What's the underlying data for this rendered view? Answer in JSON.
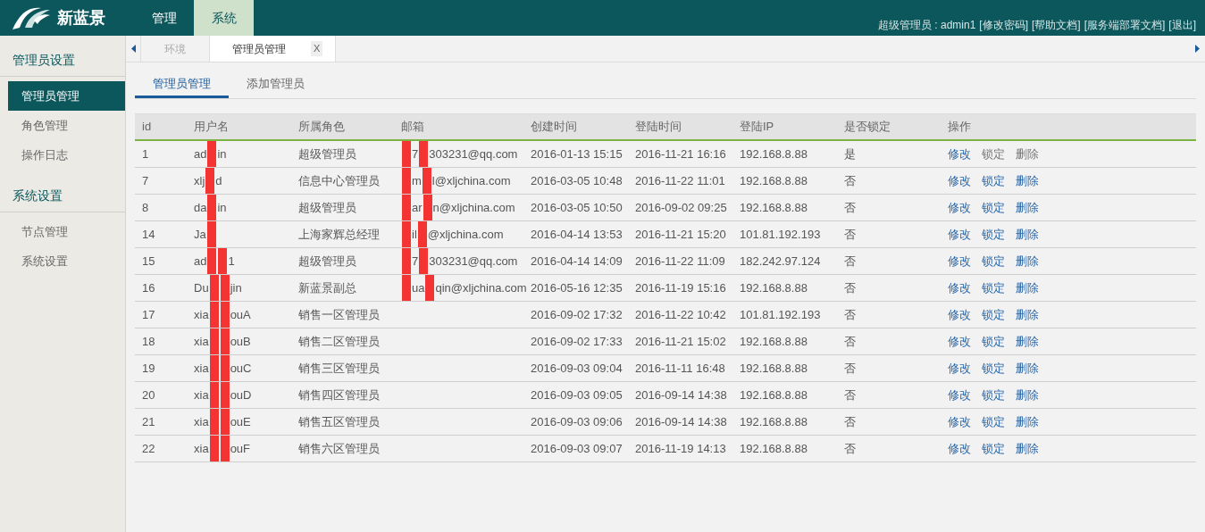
{
  "brand": {
    "name": "新蓝景"
  },
  "nav": [
    {
      "label": "管理",
      "selected": false
    },
    {
      "label": "系统",
      "selected": true
    }
  ],
  "user_bar": {
    "user": "超级管理员 : admin1",
    "links": [
      "[修改密码]",
      "[帮助文档]",
      "[服务端部署文档]",
      "[退出]"
    ]
  },
  "sidebar": [
    {
      "title": "管理员设置",
      "items": [
        {
          "label": "管理员管理",
          "selected": true
        },
        {
          "label": "角色管理",
          "selected": false
        },
        {
          "label": "操作日志",
          "selected": false
        }
      ]
    },
    {
      "title": "系统设置",
      "items": [
        {
          "label": "节点管理",
          "selected": false
        },
        {
          "label": "系统设置",
          "selected": false
        }
      ]
    }
  ],
  "page_tabs": [
    {
      "label": "环境",
      "selected": false
    },
    {
      "label": "管理员管理",
      "selected": true,
      "close": "X"
    }
  ],
  "sub_tabs": [
    {
      "label": "管理员管理",
      "selected": true
    },
    {
      "label": "添加管理员",
      "selected": false
    }
  ],
  "table": {
    "columns": [
      "id",
      "用户名",
      "所属角色",
      "邮箱",
      "创建时间",
      "登陆时间",
      "登陆IP",
      "是否锁定",
      "操作"
    ],
    "rows": [
      {
        "id": "1",
        "username": {
          "kind": "single",
          "parts": [
            "ad",
            "in"
          ]
        },
        "role": "超级管理员",
        "email": {
          "parts": [
            "7",
            "303231@qq.com"
          ]
        },
        "created": "2016-01-13 15:15",
        "login": "2016-11-21 16:16",
        "ip": "192.168.8.88",
        "locked": "是",
        "actions": [
          {
            "label": "修改",
            "disabled": false
          },
          {
            "label": "锁定",
            "disabled": true
          },
          {
            "label": "删除",
            "disabled": true
          }
        ]
      },
      {
        "id": "7",
        "username": {
          "kind": "single",
          "parts": [
            "xlj",
            "d"
          ]
        },
        "role": "信息中心管理员",
        "email": {
          "parts": [
            "m",
            "l@xljchina.com"
          ]
        },
        "created": "2016-03-05 10:48",
        "login": "2016-11-22 11:01",
        "ip": "192.168.8.88",
        "locked": "否",
        "actions": [
          {
            "label": "修改",
            "disabled": false
          },
          {
            "label": "锁定",
            "disabled": false
          },
          {
            "label": "删除",
            "disabled": false
          }
        ]
      },
      {
        "id": "8",
        "username": {
          "kind": "single",
          "parts": [
            "da",
            "in"
          ]
        },
        "role": "超级管理员",
        "email": {
          "parts": [
            "ar",
            "n@xljchina.com"
          ]
        },
        "created": "2016-03-05 10:50",
        "login": "2016-09-02 09:25",
        "ip": "192.168.8.88",
        "locked": "否",
        "actions": [
          {
            "label": "修改",
            "disabled": false
          },
          {
            "label": "锁定",
            "disabled": false
          },
          {
            "label": "删除",
            "disabled": false
          }
        ]
      },
      {
        "id": "14",
        "username": {
          "kind": "single",
          "parts": [
            "Ja"
          ]
        },
        "role": "上海家辉总经理",
        "email": {
          "parts": [
            "il",
            "@xljchina.com"
          ]
        },
        "created": "2016-04-14 13:53",
        "login": "2016-11-21 15:20",
        "ip": "101.81.192.193",
        "locked": "否",
        "actions": [
          {
            "label": "修改",
            "disabled": false
          },
          {
            "label": "锁定",
            "disabled": false
          },
          {
            "label": "删除",
            "disabled": false
          }
        ]
      },
      {
        "id": "15",
        "username": {
          "kind": "double",
          "parts": [
            "ad",
            "1"
          ]
        },
        "role": "超级管理员",
        "email": {
          "parts": [
            "7",
            "303231@qq.com"
          ]
        },
        "created": "2016-04-14 14:09",
        "login": "2016-11-22 11:09",
        "ip": "182.242.97.124",
        "locked": "否",
        "actions": [
          {
            "label": "修改",
            "disabled": false
          },
          {
            "label": "锁定",
            "disabled": false
          },
          {
            "label": "删除",
            "disabled": false
          }
        ]
      },
      {
        "id": "16",
        "username": {
          "kind": "double",
          "parts": [
            "Du",
            "jin"
          ]
        },
        "role": "新蓝景副总",
        "email": {
          "parts": [
            "ua",
            "qin@xljchina.com"
          ]
        },
        "created": "2016-05-16 12:35",
        "login": "2016-11-19 15:16",
        "ip": "192.168.8.88",
        "locked": "否",
        "actions": [
          {
            "label": "修改",
            "disabled": false
          },
          {
            "label": "锁定",
            "disabled": false
          },
          {
            "label": "删除",
            "disabled": false
          }
        ]
      },
      {
        "id": "17",
        "username": {
          "kind": "double",
          "parts": [
            "xia",
            "ouA"
          ]
        },
        "role": "销售一区管理员",
        "created": "2016-09-02 17:32",
        "login": "2016-11-22 10:42",
        "ip": "101.81.192.193",
        "locked": "否",
        "actions": [
          {
            "label": "修改",
            "disabled": false
          },
          {
            "label": "锁定",
            "disabled": false
          },
          {
            "label": "删除",
            "disabled": false
          }
        ]
      },
      {
        "id": "18",
        "username": {
          "kind": "double",
          "parts": [
            "xia",
            "ouB"
          ]
        },
        "role": "销售二区管理员",
        "created": "2016-09-02 17:33",
        "login": "2016-11-21 15:02",
        "ip": "192.168.8.88",
        "locked": "否",
        "actions": [
          {
            "label": "修改",
            "disabled": false
          },
          {
            "label": "锁定",
            "disabled": false
          },
          {
            "label": "删除",
            "disabled": false
          }
        ]
      },
      {
        "id": "19",
        "username": {
          "kind": "double",
          "parts": [
            "xia",
            "ouC"
          ]
        },
        "role": "销售三区管理员",
        "created": "2016-09-03 09:04",
        "login": "2016-11-11 16:48",
        "ip": "192.168.8.88",
        "locked": "否",
        "actions": [
          {
            "label": "修改",
            "disabled": false
          },
          {
            "label": "锁定",
            "disabled": false
          },
          {
            "label": "删除",
            "disabled": false
          }
        ]
      },
      {
        "id": "20",
        "username": {
          "kind": "double",
          "parts": [
            "xia",
            "ouD"
          ]
        },
        "role": "销售四区管理员",
        "created": "2016-09-03 09:05",
        "login": "2016-09-14 14:38",
        "ip": "192.168.8.88",
        "locked": "否",
        "actions": [
          {
            "label": "修改",
            "disabled": false
          },
          {
            "label": "锁定",
            "disabled": false
          },
          {
            "label": "删除",
            "disabled": false
          }
        ]
      },
      {
        "id": "21",
        "username": {
          "kind": "double",
          "parts": [
            "xia",
            "ouE"
          ]
        },
        "role": "销售五区管理员",
        "created": "2016-09-03 09:06",
        "login": "2016-09-14 14:38",
        "ip": "192.168.8.88",
        "locked": "否",
        "actions": [
          {
            "label": "修改",
            "disabled": false
          },
          {
            "label": "锁定",
            "disabled": false
          },
          {
            "label": "删除",
            "disabled": false
          }
        ]
      },
      {
        "id": "22",
        "username": {
          "kind": "double",
          "parts": [
            "xia",
            "ouF"
          ]
        },
        "role": "销售六区管理员",
        "created": "2016-09-03 09:07",
        "login": "2016-11-19 14:13",
        "ip": "192.168.8.88",
        "locked": "否",
        "actions": [
          {
            "label": "修改",
            "disabled": false
          },
          {
            "label": "锁定",
            "disabled": false
          },
          {
            "label": "删除",
            "disabled": false
          }
        ]
      }
    ]
  }
}
